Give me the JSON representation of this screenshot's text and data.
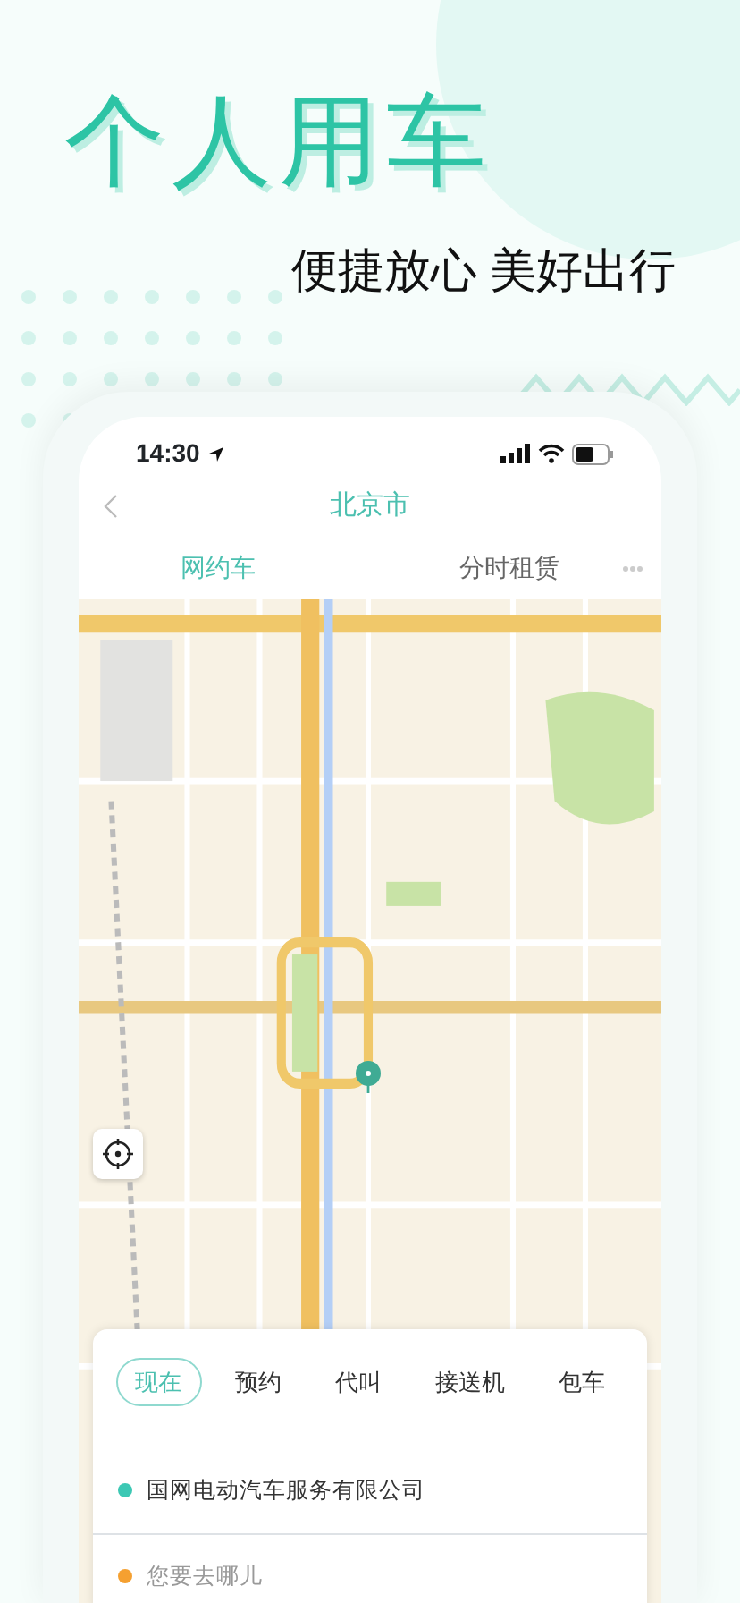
{
  "headline": "个人用车",
  "tagline": "便捷放心 美好出行",
  "status_bar": {
    "time": "14:30"
  },
  "nav": {
    "title": "北京市"
  },
  "tabs": [
    {
      "label": "网约车",
      "selected": true
    },
    {
      "label": "分时租赁",
      "selected": false
    }
  ],
  "service_options": [
    {
      "label": "现在",
      "selected": true
    },
    {
      "label": "预约",
      "selected": false
    },
    {
      "label": "代叫",
      "selected": false
    },
    {
      "label": "接送机",
      "selected": false
    },
    {
      "label": "包车",
      "selected": false
    }
  ],
  "pickup": {
    "text": "国网电动汽车服务有限公司",
    "color": "#3cc8b4"
  },
  "destination": {
    "placeholder": "您要去哪儿",
    "color": "#f5a030"
  }
}
